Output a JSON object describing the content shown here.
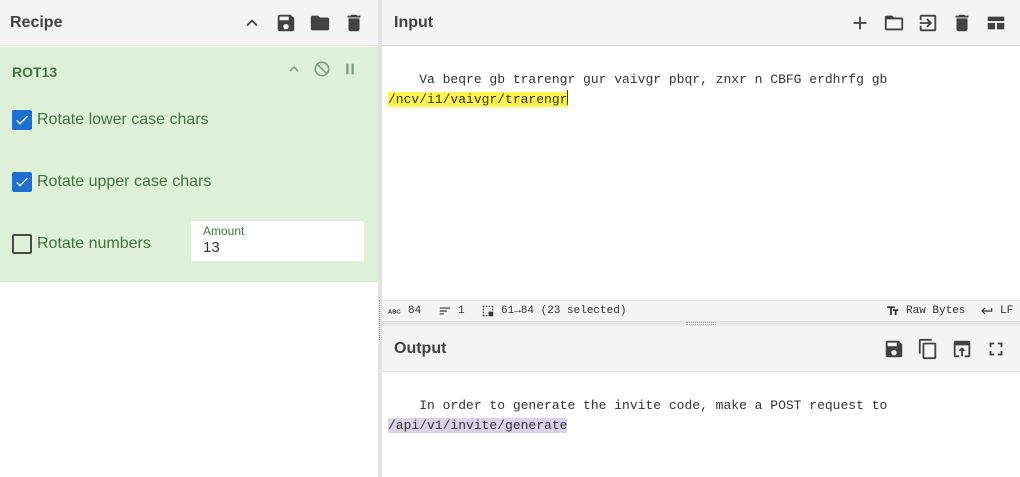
{
  "recipe": {
    "title": "Recipe",
    "icons": [
      "chevron-up-icon",
      "save-icon",
      "folder-icon",
      "trash-icon"
    ],
    "operation": {
      "name": "ROT13",
      "options": [
        {
          "label": "Rotate lower case chars",
          "checked": true
        },
        {
          "label": "Rotate upper case chars",
          "checked": true
        },
        {
          "label": "Rotate numbers",
          "checked": false
        }
      ],
      "amount": {
        "label": "Amount",
        "value": "13"
      }
    }
  },
  "input": {
    "title": "Input",
    "icons": [
      "plus-icon",
      "folder-icon",
      "open-file-icon",
      "trash-icon",
      "layout-icon"
    ],
    "line1": "Va beqre gb trarengr gur vaivgr pbqr, znxr n CBFG erdhrfg gb",
    "line2": "/ncv/i1/vaivgr/trarengr"
  },
  "status": {
    "length": "84",
    "lines": "1",
    "selection": "61→84 (23 selected)",
    "encoding": "Raw Bytes",
    "eol": "LF"
  },
  "output": {
    "title": "Output",
    "icons": [
      "save-icon",
      "copy-icon",
      "move-to-input-icon",
      "fullscreen-icon"
    ],
    "line1": "In order to generate the invite code, make a POST request to",
    "line2": "/api/v1/invite/generate"
  }
}
